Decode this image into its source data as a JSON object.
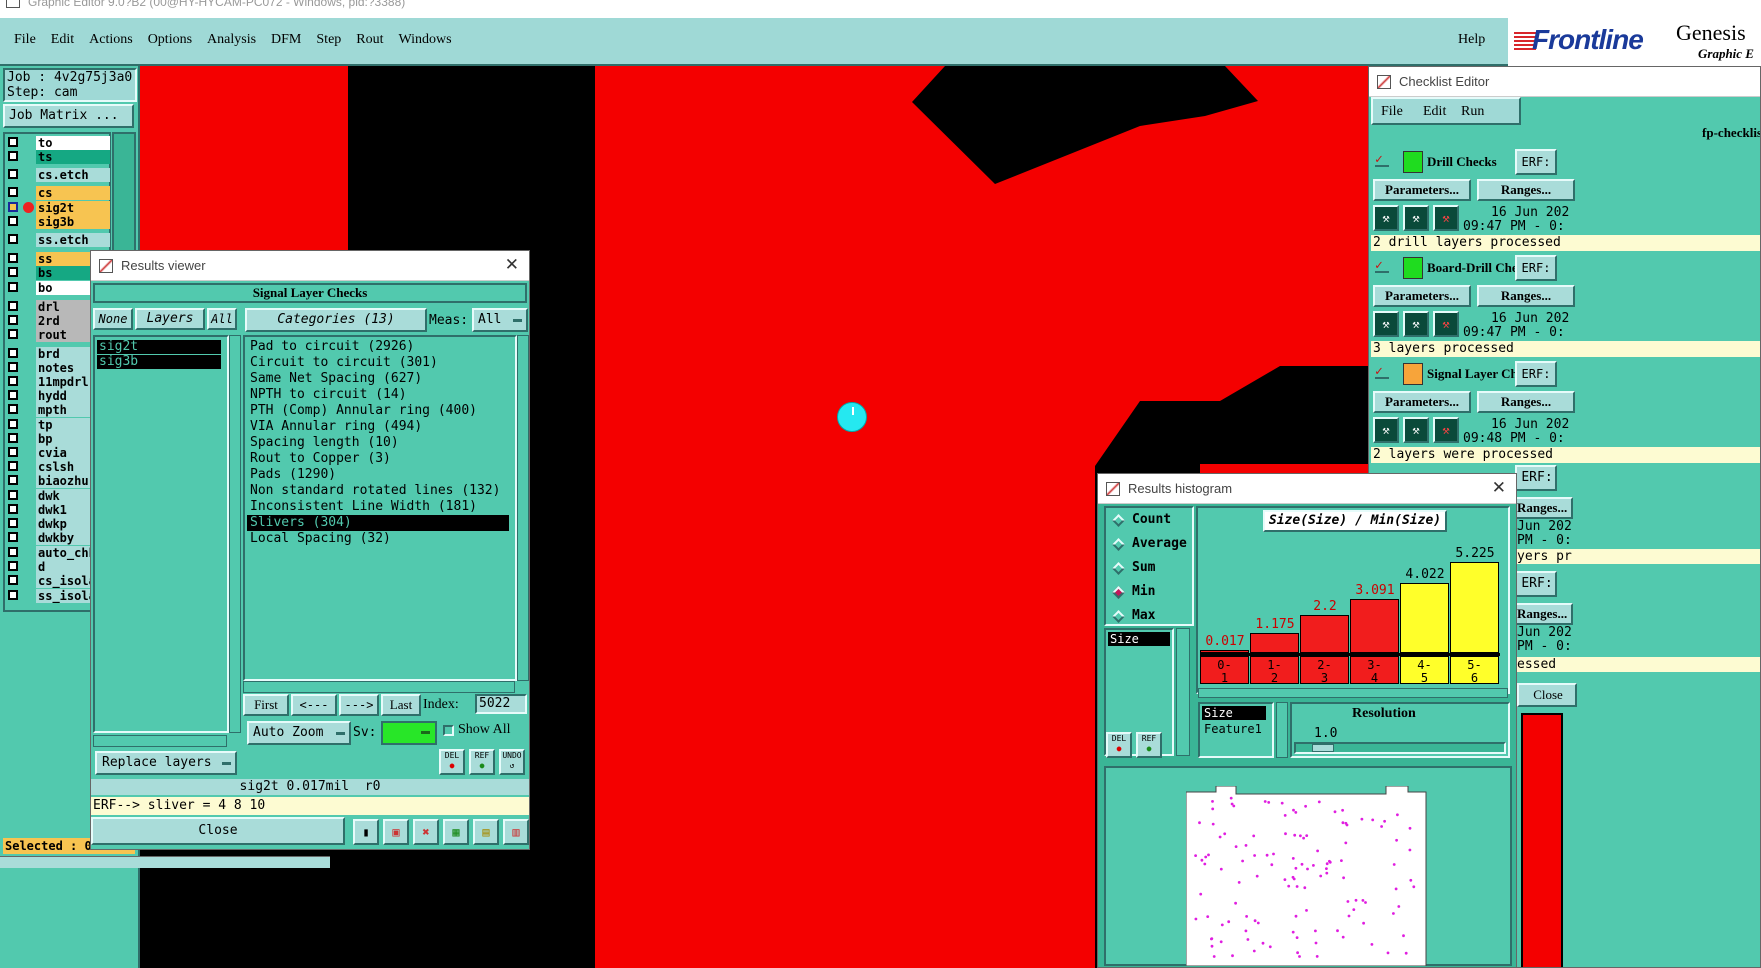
{
  "window_title": "Graphic Editor 9.0?B2 (00@HY-HYCAM-PC072 - Windows, pid:?3388)",
  "menu": {
    "items": [
      "File",
      "Edit",
      "Actions",
      "Options",
      "Analysis",
      "DFM",
      "Step",
      "Rout",
      "Windows"
    ],
    "help": "Help"
  },
  "brand": {
    "logo": "Frontline",
    "product": "Genesis",
    "subtitle": "Graphic E"
  },
  "job": {
    "job_line": "Job : 4v2g75j3a0",
    "step_line": "Step: cam",
    "matrix_button": "Job Matrix ..."
  },
  "layers": [
    {
      "name": "to",
      "color": "#ffffff"
    },
    {
      "name": "ts",
      "color": "#15a883"
    },
    {
      "name": "cs.etch",
      "color": "#a9dcd9"
    },
    {
      "name": "cs",
      "color": "#f7c451"
    },
    {
      "name": "sig2t",
      "color": "#f7c451"
    },
    {
      "name": "sig3b",
      "color": "#f7c451"
    },
    {
      "name": "ss.etch",
      "color": "#a9dcd9"
    },
    {
      "name": "ss",
      "color": "#f7c451"
    },
    {
      "name": "bs",
      "color": "#15a883"
    },
    {
      "name": "bo",
      "color": "#ffffff"
    },
    {
      "name": "drl",
      "color": "#b8b8b8"
    },
    {
      "name": "2rd",
      "color": "#b8b8b8"
    },
    {
      "name": "rout",
      "color": "#b8b8b8"
    },
    {
      "name": "brd",
      "color": "#a9dcd9"
    },
    {
      "name": "notes",
      "color": "#a9dcd9"
    },
    {
      "name": "11mpdrl",
      "color": "#a9dcd9"
    },
    {
      "name": "hydd",
      "color": "#a9dcd9"
    },
    {
      "name": "mpth",
      "color": "#a9dcd9"
    },
    {
      "name": "tp",
      "color": "#a9dcd9"
    },
    {
      "name": "bp",
      "color": "#a9dcd9"
    },
    {
      "name": "cvia",
      "color": "#a9dcd9"
    },
    {
      "name": "cslsh",
      "color": "#a9dcd9"
    },
    {
      "name": "biaozhu",
      "color": "#a9dcd9"
    },
    {
      "name": "dwk",
      "color": "#a9dcd9"
    },
    {
      "name": "dwk1",
      "color": "#a9dcd9"
    },
    {
      "name": "dwkp",
      "color": "#a9dcd9"
    },
    {
      "name": "dwkby",
      "color": "#a9dcd9"
    },
    {
      "name": "auto_chk",
      "color": "#a9dcd9"
    },
    {
      "name": "d",
      "color": "#a9dcd9"
    },
    {
      "name": "cs_isola",
      "color": "#a9dcd9"
    },
    {
      "name": "ss_isola",
      "color": "#a9dcd9"
    }
  ],
  "selected_status": "Selected : 0",
  "results_viewer": {
    "title": "Results viewer",
    "header": "Signal Layer Checks",
    "none_btn": "None",
    "layers_btn": "Layers",
    "all_btn": "All",
    "categories_btn": "Categories (13)",
    "meas_label": "Meas:",
    "meas_value": "All",
    "layer_list": [
      "sig2t",
      "sig3b"
    ],
    "categories": [
      "Pad to circuit (2926)",
      "Circuit to circuit (301)",
      "Same Net Spacing (627)",
      "NPTH to circuit (14)",
      "PTH (Comp) Annular ring (400)",
      "VIA Annular ring (494)",
      "Spacing length (10)",
      "Rout to Copper (3)",
      "Pads (1290)",
      "Non standard rotated lines (132)",
      "Inconsistent Line Width (181)",
      "Slivers (304)",
      "Local Spacing (32)"
    ],
    "selected_category": "Slivers (304)",
    "first": "First",
    "prev": "<---",
    "next": "--->",
    "last": "Last",
    "index_label": "Index:",
    "index_value": "5022",
    "auto_zoom": "Auto Zoom",
    "sv_label": "Sv:",
    "show_all": "Show All",
    "replace_layers": "Replace layers",
    "del": "DEL",
    "ref": "REF",
    "undo": "UNDO",
    "status_line": "sig2t 0.017mil  r0",
    "erf_line": "ERF--> sliver = 4 8 10",
    "close": "Close"
  },
  "checklist": {
    "title": "Checklist Editor",
    "menu": [
      "File",
      "Edit",
      "Run"
    ],
    "checklist_name": "fp-checklis",
    "checks": [
      {
        "name": "Drill Checks",
        "erf": "ERF:",
        "params": "Parameters...",
        "ranges": "Ranges...",
        "date": "16 Jun 202",
        "time": "09:47 PM - 0:",
        "status": "2 drill layers processed"
      },
      {
        "name": "Board-Drill Che",
        "erf": "ERF:",
        "params": "Parameters...",
        "ranges": "Ranges...",
        "date": "16 Jun 202",
        "time": "09:47 PM - 0:",
        "status": "3 layers processed"
      },
      {
        "name": "Signal Layer Ch",
        "erf": "ERF:",
        "params": "Parameters...",
        "ranges": "Ranges...",
        "date": "16 Jun 202",
        "time": "09:48 PM - 0:",
        "status": "2 layers were processed"
      }
    ],
    "partial": {
      "erf1": "ERF:",
      "ranges1": "Ranges...",
      "jun1": "Jun 202",
      "pm1": "PM - 0:",
      "yers": "yers pr",
      "erf2": "ERF:",
      "ranges2": "Ranges...",
      "jun2": "Jun 202",
      "pm2": "PM - 0:",
      "essed": "essed",
      "close": "Close"
    }
  },
  "histogram": {
    "title": "Results histogram",
    "modes": [
      "Count",
      "Average",
      "Sum",
      "Min",
      "Max"
    ],
    "selected_mode": "Min",
    "chart_title": "Size(Size) / Min(Size)",
    "left_list": [
      "Size"
    ],
    "attr_list": [
      "Size",
      "Feature1"
    ],
    "resolution_label": "Resolution",
    "resolution_value": "1.0",
    "del": "DEL",
    "ref": "REF"
  },
  "chart_data": {
    "type": "bar",
    "title": "Size(Size) / Min(Size)",
    "categories": [
      "0-1",
      "1-2",
      "2-3",
      "3-4",
      "4-5",
      "5-6"
    ],
    "values": [
      0.017,
      1.175,
      2.2,
      3.091,
      4.022,
      5.225
    ],
    "value_labels": [
      "0.017",
      "1.175",
      "2.2",
      "3.091",
      "4.022",
      "5.225"
    ],
    "colors": [
      "#f11d1d",
      "#f11d1d",
      "#f11d1d",
      "#f11d1d",
      "#ffff2a",
      "#ffff2a"
    ],
    "ylim": [
      0,
      6
    ]
  }
}
